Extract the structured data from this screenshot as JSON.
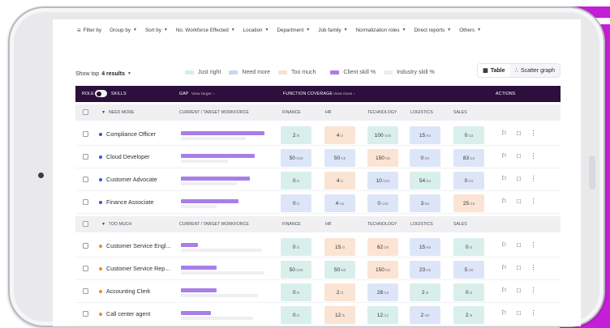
{
  "filters": [
    {
      "label": "Filter by"
    },
    {
      "label": "Group by"
    },
    {
      "label": "Sort by"
    },
    {
      "label": "No. Workforce Effected"
    },
    {
      "label": "Location"
    },
    {
      "label": "Department"
    },
    {
      "label": "Job family"
    },
    {
      "label": "Normalization roles"
    },
    {
      "label": "Direct reports"
    },
    {
      "label": "Others"
    }
  ],
  "toolbar": {
    "show_top_label": "Show top",
    "show_top_value": "4 results",
    "legend": [
      {
        "label": "Just right",
        "color": "#d4efe9"
      },
      {
        "label": "Need more",
        "color": "#c9d7f4"
      },
      {
        "label": "Too much",
        "color": "#fbe0cc"
      },
      {
        "label": "Client skill %",
        "color": "#a97ee8"
      },
      {
        "label": "Industry skill %",
        "color": "#ececf0"
      }
    ],
    "table_label": "Table",
    "scatter_label": "Scatter graph"
  },
  "header": {
    "role": "ROLE",
    "skills": "SKILLS",
    "gap": "GAP",
    "view_larger": "View larger",
    "function_coverage": "FUNCTION COVERAGE",
    "view_more": "View more",
    "actions": "ACTIONS"
  },
  "groups": [
    {
      "name": "NEED MORE",
      "col_current": "CURRENT / TARGET WORKFORCE",
      "cols": [
        "FINANCE",
        "HR",
        "TECHNOLOGY",
        "LOGISTICS",
        "SALES"
      ],
      "dot_color": "#2f5bd6",
      "rows": [
        {
          "role": "Compliance Officer",
          "client": 0.98,
          "industry": 0.76,
          "cells": [
            {
              "v": "2",
              "t": "/5",
              "c": "g"
            },
            {
              "v": "4",
              "t": "/2",
              "c": "o"
            },
            {
              "v": "100",
              "t": "/100",
              "c": "g"
            },
            {
              "v": "15",
              "t": "/64",
              "c": "b"
            },
            {
              "v": "0",
              "t": "/15",
              "c": "g"
            }
          ]
        },
        {
          "role": "Cloud Developer",
          "client": 0.87,
          "industry": 0.55,
          "cells": [
            {
              "v": "50",
              "t": "/100",
              "c": "b"
            },
            {
              "v": "50",
              "t": "/15",
              "c": "b"
            },
            {
              "v": "150",
              "t": "/30",
              "c": "o"
            },
            {
              "v": "0",
              "t": "/64",
              "c": "b"
            },
            {
              "v": "83",
              "t": "/15",
              "c": "b"
            }
          ]
        },
        {
          "role": "Customer Advocate",
          "client": 0.81,
          "industry": 0.66,
          "cells": [
            {
              "v": "0",
              "t": "/5",
              "c": "g"
            },
            {
              "v": "4",
              "t": "/1",
              "c": "o"
            },
            {
              "v": "10",
              "t": "/100",
              "c": "b"
            },
            {
              "v": "54",
              "t": "/64",
              "c": "g"
            },
            {
              "v": "0",
              "t": "/15",
              "c": "b"
            }
          ]
        },
        {
          "role": "Finance Associate",
          "client": 0.68,
          "industry": 0.42,
          "cells": [
            {
              "v": "0",
              "t": "/4",
              "c": "b"
            },
            {
              "v": "4",
              "t": "/15",
              "c": "b"
            },
            {
              "v": "0",
              "t": "/100",
              "c": "b"
            },
            {
              "v": "3",
              "t": "/64",
              "c": "b"
            },
            {
              "v": "25",
              "t": "/15",
              "c": "o"
            }
          ]
        }
      ]
    },
    {
      "name": "TOO MUCH",
      "col_current": "CURRENT / TARGET WORKFORCE",
      "cols": [
        "FINANCE",
        "HR",
        "TECHNOLOGY",
        "LOGISTICS",
        "SALES"
      ],
      "dot_color": "#ef8a2a",
      "rows": [
        {
          "role": "Customer Service Engl...",
          "client": 0.2,
          "industry": 0.95,
          "cells": [
            {
              "v": "0",
              "t": "/3",
              "c": "g"
            },
            {
              "v": "15",
              "t": "/3",
              "c": "o"
            },
            {
              "v": "62",
              "t": "/30",
              "c": "o"
            },
            {
              "v": "15",
              "t": "/60",
              "c": "b"
            },
            {
              "v": "0",
              "t": "/3",
              "c": "g"
            }
          ]
        },
        {
          "role": "Customer Service Rep...",
          "client": 0.42,
          "industry": 0.98,
          "cells": [
            {
              "v": "50",
              "t": "/100",
              "c": "g"
            },
            {
              "v": "50",
              "t": "/50",
              "c": "g"
            },
            {
              "v": "150",
              "t": "/30",
              "c": "o"
            },
            {
              "v": "23",
              "t": "/45",
              "c": "b"
            },
            {
              "v": "5",
              "t": "/20",
              "c": "b"
            }
          ]
        },
        {
          "role": "Accounting Clerk",
          "client": 0.42,
          "industry": 0.9,
          "cells": [
            {
              "v": "0",
              "t": "/5",
              "c": "g"
            },
            {
              "v": "2",
              "t": "/3",
              "c": "o"
            },
            {
              "v": "28",
              "t": "/15",
              "c": "b"
            },
            {
              "v": "2",
              "t": "/5",
              "c": "g"
            },
            {
              "v": "0",
              "t": "/3",
              "c": "g"
            }
          ]
        },
        {
          "role": "Call center agent",
          "client": 0.35,
          "industry": 0.85,
          "cells": [
            {
              "v": "0",
              "t": "/3",
              "c": "g"
            },
            {
              "v": "12",
              "t": "/5",
              "c": "o"
            },
            {
              "v": "12",
              "t": "/12",
              "c": "g"
            },
            {
              "v": "2",
              "t": "/50",
              "c": "b"
            },
            {
              "v": "2",
              "t": "/5",
              "c": "g"
            }
          ]
        }
      ]
    }
  ]
}
